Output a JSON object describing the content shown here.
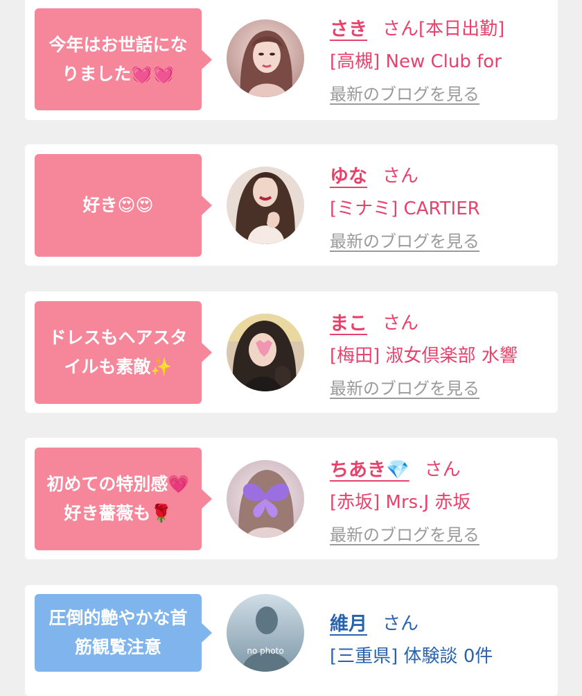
{
  "entries": [
    {
      "comment": "今年はお世話にな\nりました💓💓",
      "name": "さき",
      "honorific": "さん",
      "tag": "[本日出勤]",
      "shop": "[高槻] New Club for",
      "blog_link": "最新のブログを見る",
      "bubble_color": "#f6879a"
    },
    {
      "comment": "好き😍😍",
      "name": "ゆな",
      "honorific": "さん",
      "shop": "[ミナミ] CARTIER",
      "blog_link": "最新のブログを見る",
      "bubble_color": "#f6879a"
    },
    {
      "comment": "ドレスもヘアスタ\nイルも素敵✨",
      "name": "まこ",
      "honorific": "さん",
      "shop": "[梅田] 淑女倶楽部 水響",
      "blog_link": "最新のブログを見る",
      "bubble_color": "#f6879a"
    },
    {
      "comment": "初めての特別感💗\n好き薔薇も🌹",
      "name": "ちあき💎",
      "honorific": "さん",
      "shop": "[赤坂] Mrs.J 赤坂",
      "blog_link": "最新のブログを見る",
      "bubble_color": "#f6879a"
    },
    {
      "comment": "圧倒的艶やかな首\n筋観覧注意",
      "name": "維月",
      "honorific": "さん",
      "shop": "[三重県] 体験談 0件",
      "avatar_text": "no photo",
      "bubble_color": "#7fb4ec"
    }
  ],
  "colors": {
    "pink_text": "#e8416b",
    "blue_text": "#2a63ad",
    "link_gray": "#9a9a9a",
    "background": "#efefef"
  }
}
